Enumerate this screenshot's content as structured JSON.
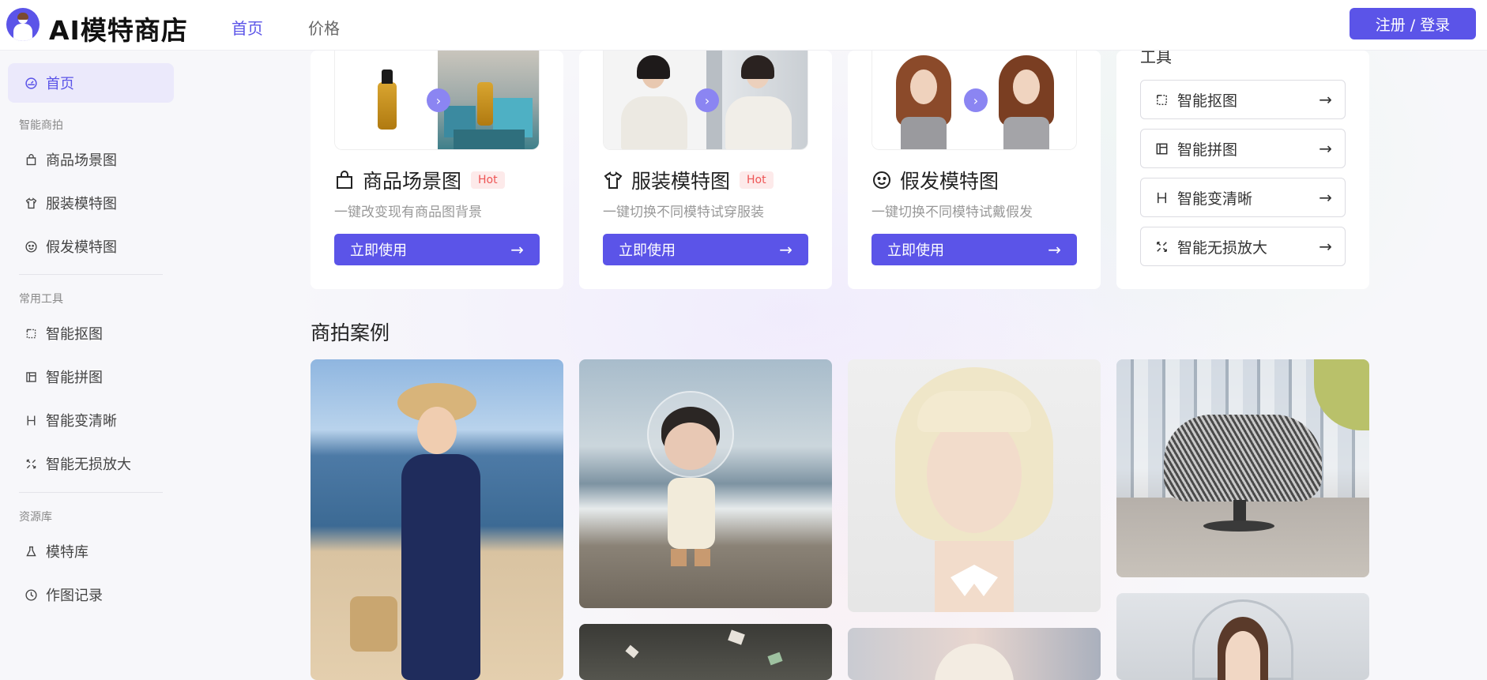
{
  "header": {
    "app_title": "AI模特商店",
    "nav": [
      {
        "label": "首页",
        "active": true
      },
      {
        "label": "价格",
        "active": false
      }
    ],
    "login_label": "注册 / 登录"
  },
  "sidebar": {
    "home": {
      "label": "首页",
      "icon": "dashboard-icon"
    },
    "sections": [
      {
        "title": "智能商拍",
        "items": [
          {
            "label": "商品场景图",
            "icon": "shopping-bag-icon"
          },
          {
            "label": "服装模特图",
            "icon": "shirt-icon"
          },
          {
            "label": "假发模特图",
            "icon": "smile-icon"
          }
        ]
      },
      {
        "title": "常用工具",
        "items": [
          {
            "label": "智能抠图",
            "icon": "crop-icon"
          },
          {
            "label": "智能拼图",
            "icon": "layout-icon"
          },
          {
            "label": "智能变清晰",
            "icon": "heading-icon"
          },
          {
            "label": "智能无损放大",
            "icon": "expand-icon"
          }
        ]
      },
      {
        "title": "资源库",
        "items": [
          {
            "label": "模特库",
            "icon": "flask-icon"
          },
          {
            "label": "作图记录",
            "icon": "clock-icon"
          }
        ]
      }
    ]
  },
  "feature_cards": [
    {
      "title": "商品场景图",
      "badge": "Hot",
      "desc": "一键改变现有商品图背景",
      "button": "立即使用",
      "icon": "shopping-bag-icon"
    },
    {
      "title": "服装模特图",
      "badge": "Hot",
      "desc": "一键切换不同模特试穿服装",
      "button": "立即使用",
      "icon": "shirt-icon"
    },
    {
      "title": "假发模特图",
      "badge": "",
      "desc": "一键切换不同模特试戴假发",
      "button": "立即使用",
      "icon": "smile-icon"
    }
  ],
  "tools_card": {
    "title": "工具",
    "items": [
      {
        "label": "智能抠图",
        "icon": "crop-icon"
      },
      {
        "label": "智能拼图",
        "icon": "layout-icon"
      },
      {
        "label": "智能变清晰",
        "icon": "heading-icon"
      },
      {
        "label": "智能无损放大",
        "icon": "expand-icon"
      }
    ]
  },
  "cases": {
    "heading": "商拍案例"
  },
  "colors": {
    "accent": "#5b54e8",
    "accent_light": "#ebe9fb",
    "hot_bg": "#fdeaea",
    "hot_text": "#ee5555"
  }
}
